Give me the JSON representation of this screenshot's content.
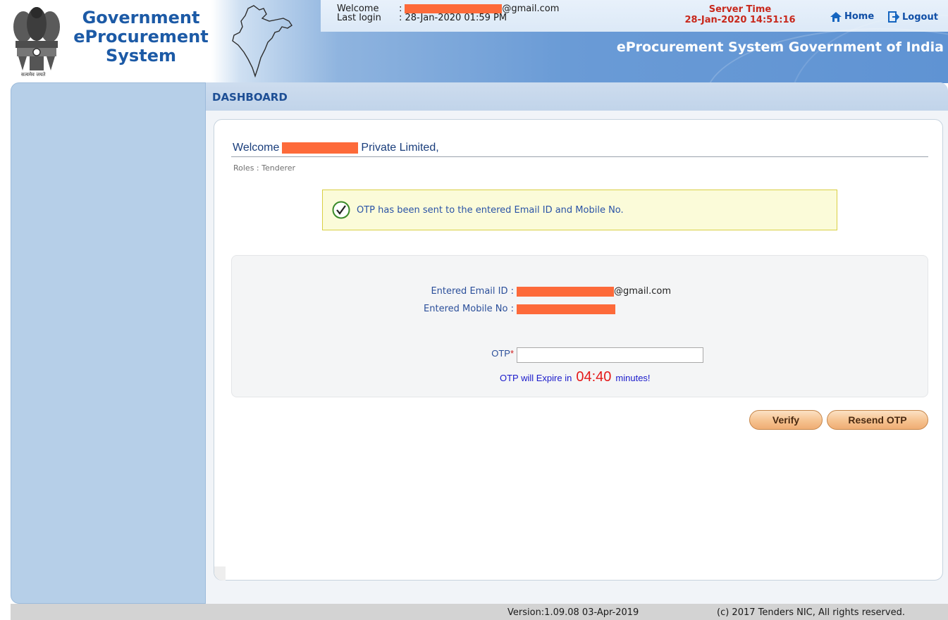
{
  "header": {
    "logo_lines": [
      "Government",
      "eProcurement",
      "System"
    ],
    "emblem_motto": "सत्यमेव जयते",
    "welcome_label": "Welcome",
    "welcome_sep": ":",
    "welcome_email_suffix": "@gmail.com",
    "last_login_label": "Last login",
    "last_login_value": ": 28-Jan-2020 01:59 PM",
    "server_time_label": "Server Time",
    "server_time_value": "28-Jan-2020 14:51:16",
    "home_label": "Home",
    "logout_label": "Logout",
    "portal_title": "eProcurement System Government of India",
    "home_icon": "home-icon",
    "logout_icon": "logout-icon"
  },
  "dashboard": {
    "title": "DASHBOARD",
    "welcome_prefix": "Welcome",
    "welcome_suffix": "Private Limited,",
    "roles": "Roles : Tenderer"
  },
  "otp_message": {
    "text": "OTP has been sent to the entered Email ID and Mobile No.",
    "icon": "check-circle-icon"
  },
  "form": {
    "email_label": "Entered Email ID  :",
    "email_suffix": "@gmail.com",
    "mobile_label": "Entered Mobile No  :",
    "otp_label": "OTP",
    "otp_required_mark": "*",
    "otp_value": "",
    "expire_prefix": "OTP will Expire in",
    "expire_time": "04:40",
    "expire_suffix": "minutes!"
  },
  "buttons": {
    "verify": "Verify",
    "resend": "Resend OTP"
  },
  "footer": {
    "version": "Version:1.09.08 03-Apr-2019",
    "copyright": "(c) 2017 Tenders NIC, All rights reserved."
  },
  "colors": {
    "redaction": "#fd6a3a",
    "header_blue": "#5f93d3",
    "sidebar": "#b6cfe8",
    "brand_text": "#1c5aa6"
  }
}
